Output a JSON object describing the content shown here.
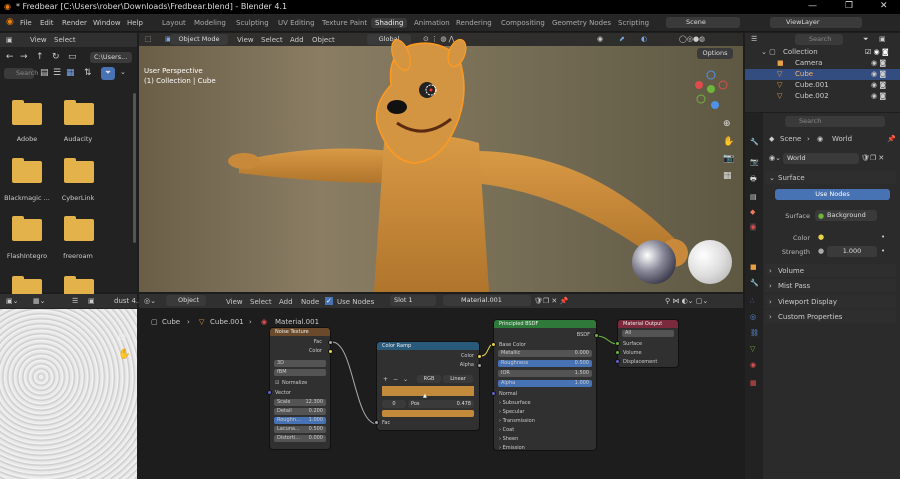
{
  "title": "* Fredbear [C:\\Users\\rober\\Downloads\\Fredbear.blend] - Blender 4.1",
  "menu": [
    "File",
    "Edit",
    "Render",
    "Window",
    "Help"
  ],
  "workspaces": [
    "Layout",
    "Modeling",
    "Sculpting",
    "UV Editing",
    "Texture Paint",
    "Shading",
    "Animation",
    "Rendering",
    "Compositing",
    "Geometry Nodes",
    "Scripting"
  ],
  "active_workspace": "Shading",
  "scene": "Scene",
  "view_layer": "ViewLayer",
  "filebrowser": {
    "view": "View",
    "select": "Select",
    "path": "C:\\Users...",
    "search": "Search",
    "folders": [
      "Adobe",
      "Audacity",
      "Blackmagic ...",
      "CyberLink",
      "FlashIntegro",
      "freeroam"
    ]
  },
  "viewport": {
    "mode": "Object Mode",
    "menus": [
      "View",
      "Select",
      "Add",
      "Object"
    ],
    "orientation": "Global",
    "options": "Options",
    "persp": "User Perspective",
    "collection": "(1) Collection | Cube"
  },
  "imageview": {
    "name": "dust 4..."
  },
  "nodeeditor": {
    "type": "Object",
    "menus": [
      "View",
      "Select",
      "Add",
      "Node"
    ],
    "use_nodes": "Use Nodes",
    "slot": "Slot 1",
    "material": "Material.001",
    "breadcrumb": [
      "Cube",
      "Cube.001",
      "Material.001"
    ]
  },
  "nodes": {
    "noise": {
      "title": "Noise Texture",
      "out_fac": "Fac",
      "out_color": "Color",
      "dim": "3D",
      "type": "fBM",
      "normalize": "Normalize",
      "vector": "Vector",
      "rows": [
        [
          "Scale",
          "12.300"
        ],
        [
          "Detail",
          "0.200"
        ],
        [
          "Roughn...",
          "1.000"
        ],
        [
          "Lacuna...",
          "0.500"
        ],
        [
          "Distorti...",
          "0.000"
        ]
      ]
    },
    "ramp": {
      "title": "Color Ramp",
      "out_color": "Color",
      "out_alpha": "Alpha",
      "mode": "RGB",
      "interp": "Linear",
      "idx": "0",
      "pos_label": "Pos",
      "pos": "0.478",
      "fac": "Fac"
    },
    "bsdf": {
      "title": "Principled BSDF",
      "out": "BSDF",
      "base": "Base Color",
      "rows": [
        [
          "Metallic",
          "0.000"
        ],
        [
          "Roughness",
          "0.500"
        ],
        [
          "IOR",
          "1.500"
        ],
        [
          "Alpha",
          "1.000"
        ]
      ],
      "normal": "Normal",
      "panels": [
        "Subsurface",
        "Specular",
        "Transmission",
        "Coat",
        "Sheen",
        "Emission"
      ]
    },
    "output": {
      "title": "Material Output",
      "target": "All",
      "inputs": [
        "Surface",
        "Volume",
        "Displacement"
      ]
    }
  },
  "outliner": {
    "search": "Search",
    "items": [
      "Collection",
      "Camera",
      "Cube",
      "Cube.001",
      "Cube.002"
    ]
  },
  "properties": {
    "search": "Search",
    "crumb_scene": "Scene",
    "crumb_world": "World",
    "world": "World",
    "surface": "Surface",
    "use_nodes": "Use Nodes",
    "surface_label": "Surface",
    "surface_val": "Background",
    "color_label": "Color",
    "strength_label": "Strength",
    "strength_val": "1.000",
    "sections": [
      "Volume",
      "Mist Pass",
      "Viewport Display",
      "Custom Properties"
    ]
  }
}
